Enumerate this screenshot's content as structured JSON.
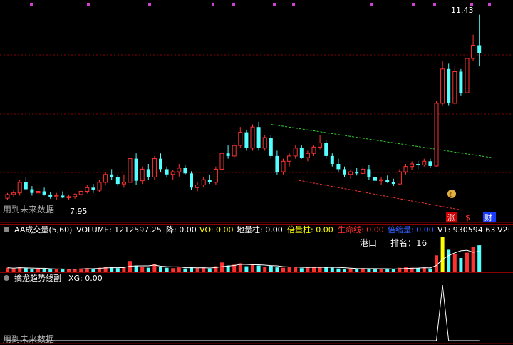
{
  "main": {
    "price_high_label": "11.43",
    "price_low_label": "7.95",
    "future_data_note": "用到未来数据",
    "badge_up": "涨",
    "badge_money": "$",
    "badge_finance": "财"
  },
  "volume_panel": {
    "title": "AA成交量(5,60)",
    "volume_label": "VOLUME: 1212597.25",
    "drop_label": "降: 0.00",
    "vo_label": "VO: 0.00",
    "ground_label": "地量柱: 0.00",
    "double_label": "倍量柱: 0.00",
    "life_label": "生命线: 0.00",
    "shrink_label": "倍缩量: 0.00",
    "v1_label": "V1: 930594.63",
    "v2_label": "V2:",
    "port_label": "港口",
    "rank_label": "排名：16"
  },
  "indicator_panel": {
    "title": "擒龙趋势线副",
    "xg_label": "XG: 0.00",
    "future_data_note": "用到未来数据"
  },
  "colors": {
    "up": "#ff3232",
    "down": "#54ffff",
    "grid": "#8b0000",
    "text_white": "#ffffff",
    "text_yellow": "#ffff00",
    "text_red": "#ff3030",
    "text_blue": "#3060ff",
    "green_trend": "#33cc33"
  },
  "chart_data": {
    "type": "candlestick",
    "ohlc": [
      [
        7.95,
        8.05,
        7.92,
        8.02
      ],
      [
        8.02,
        8.1,
        7.98,
        8.05
      ],
      [
        8.05,
        8.3,
        8.0,
        8.25
      ],
      [
        8.25,
        8.35,
        8.1,
        8.12
      ],
      [
        8.12,
        8.18,
        8.0,
        8.05
      ],
      [
        8.05,
        8.12,
        7.95,
        8.08
      ],
      [
        8.08,
        8.15,
        8.0,
        8.02
      ],
      [
        8.02,
        8.06,
        7.94,
        7.98
      ],
      [
        7.98,
        8.05,
        7.92,
        8.0
      ],
      [
        8.0,
        8.08,
        7.95,
        7.96
      ],
      [
        7.96,
        8.02,
        7.92,
        7.98
      ],
      [
        7.98,
        8.04,
        7.94,
        8.02
      ],
      [
        8.02,
        8.1,
        7.98,
        8.08
      ],
      [
        8.08,
        8.2,
        8.04,
        8.15
      ],
      [
        8.15,
        8.22,
        8.05,
        8.1
      ],
      [
        8.1,
        8.3,
        8.06,
        8.25
      ],
      [
        8.25,
        8.45,
        8.2,
        8.4
      ],
      [
        8.4,
        8.5,
        8.3,
        8.35
      ],
      [
        8.35,
        8.4,
        8.18,
        8.22
      ],
      [
        8.22,
        8.4,
        8.15,
        8.25
      ],
      [
        8.25,
        9.05,
        8.2,
        8.7
      ],
      [
        8.7,
        8.8,
        8.2,
        8.28
      ],
      [
        8.28,
        8.55,
        8.22,
        8.5
      ],
      [
        8.5,
        8.6,
        8.3,
        8.35
      ],
      [
        8.35,
        8.75,
        8.3,
        8.7
      ],
      [
        8.7,
        8.8,
        8.45,
        8.5
      ],
      [
        8.5,
        8.55,
        8.35,
        8.4
      ],
      [
        8.4,
        8.48,
        8.3,
        8.45
      ],
      [
        8.45,
        8.6,
        8.36,
        8.52
      ],
      [
        8.52,
        8.58,
        8.4,
        8.42
      ],
      [
        8.42,
        8.46,
        8.1,
        8.15
      ],
      [
        8.15,
        8.25,
        8.08,
        8.2
      ],
      [
        8.2,
        8.35,
        8.15,
        8.3
      ],
      [
        8.3,
        8.4,
        8.22,
        8.25
      ],
      [
        8.25,
        8.55,
        8.2,
        8.5
      ],
      [
        8.5,
        8.85,
        8.45,
        8.8
      ],
      [
        8.8,
        8.95,
        8.7,
        8.75
      ],
      [
        8.75,
        9.0,
        8.7,
        8.95
      ],
      [
        8.95,
        9.3,
        8.9,
        9.2
      ],
      [
        9.2,
        9.25,
        8.85,
        8.9
      ],
      [
        8.9,
        9.35,
        8.85,
        9.3
      ],
      [
        9.3,
        9.4,
        8.85,
        8.9
      ],
      [
        8.9,
        9.15,
        8.85,
        9.1
      ],
      [
        9.1,
        9.15,
        8.7,
        8.75
      ],
      [
        8.75,
        8.85,
        8.4,
        8.45
      ],
      [
        8.45,
        8.7,
        8.4,
        8.65
      ],
      [
        8.65,
        8.8,
        8.55,
        8.75
      ],
      [
        8.75,
        8.95,
        8.7,
        8.9
      ],
      [
        8.9,
        8.95,
        8.7,
        8.72
      ],
      [
        8.72,
        8.85,
        8.65,
        8.8
      ],
      [
        8.8,
        8.95,
        8.75,
        8.92
      ],
      [
        8.92,
        9.15,
        8.88,
        9.0
      ],
      [
        9.0,
        9.05,
        8.7,
        8.75
      ],
      [
        8.75,
        8.8,
        8.55,
        8.6
      ],
      [
        8.6,
        8.7,
        8.45,
        8.5
      ],
      [
        8.5,
        8.55,
        8.35,
        8.4
      ],
      [
        8.4,
        8.5,
        8.32,
        8.45
      ],
      [
        8.45,
        8.52,
        8.38,
        8.42
      ],
      [
        8.42,
        8.55,
        8.38,
        8.5
      ],
      [
        8.5,
        8.58,
        8.3,
        8.35
      ],
      [
        8.35,
        8.4,
        8.22,
        8.28
      ],
      [
        8.28,
        8.35,
        8.2,
        8.3
      ],
      [
        8.3,
        8.38,
        8.24,
        8.26
      ],
      [
        8.26,
        8.32,
        8.18,
        8.22
      ],
      [
        8.22,
        8.5,
        8.2,
        8.45
      ],
      [
        8.45,
        8.6,
        8.4,
        8.55
      ],
      [
        8.55,
        8.65,
        8.48,
        8.6
      ],
      [
        8.6,
        8.66,
        8.5,
        8.58
      ],
      [
        8.58,
        8.7,
        8.55,
        8.65
      ],
      [
        8.65,
        8.7,
        8.52,
        8.56
      ],
      [
        8.56,
        9.8,
        8.55,
        9.75
      ],
      [
        9.75,
        10.55,
        9.7,
        10.4
      ],
      [
        10.4,
        10.5,
        9.7,
        9.75
      ],
      [
        9.75,
        10.45,
        9.72,
        10.35
      ],
      [
        10.35,
        10.4,
        9.9,
        9.95
      ],
      [
        9.95,
        10.7,
        9.92,
        10.6
      ],
      [
        10.6,
        11.05,
        10.55,
        10.85
      ],
      [
        10.85,
        11.43,
        10.45,
        10.7
      ]
    ],
    "volume": [
      12,
      10,
      14,
      11,
      9,
      10,
      9,
      8,
      8,
      9,
      8,
      9,
      10,
      11,
      10,
      12,
      15,
      13,
      11,
      12,
      30,
      18,
      14,
      12,
      22,
      15,
      12,
      11,
      13,
      10,
      14,
      11,
      12,
      10,
      16,
      26,
      18,
      20,
      24,
      16,
      22,
      18,
      15,
      17,
      13,
      12,
      14,
      15,
      11,
      12,
      13,
      15,
      14,
      12,
      10,
      9,
      10,
      9,
      11,
      10,
      9,
      8,
      9,
      8,
      12,
      13,
      12,
      11,
      12,
      10,
      45,
      95,
      60,
      48,
      38,
      52,
      68,
      72
    ],
    "xg_signal": [
      0,
      0,
      0,
      0,
      0,
      0,
      0,
      0,
      0,
      0,
      0,
      0,
      0,
      0,
      0,
      0,
      0,
      0,
      0,
      0,
      0,
      0,
      0,
      0,
      0,
      0,
      0,
      0,
      0,
      0,
      0,
      0,
      0,
      0,
      0,
      0,
      0,
      0,
      0,
      0,
      0,
      0,
      0,
      0,
      0,
      0,
      0,
      0,
      0,
      0,
      0,
      0,
      0,
      0,
      0,
      0,
      0,
      0,
      0,
      0,
      0,
      0,
      0,
      0,
      0,
      0,
      0,
      0,
      0,
      0,
      0,
      1,
      0,
      0,
      0,
      0,
      0,
      0
    ]
  }
}
